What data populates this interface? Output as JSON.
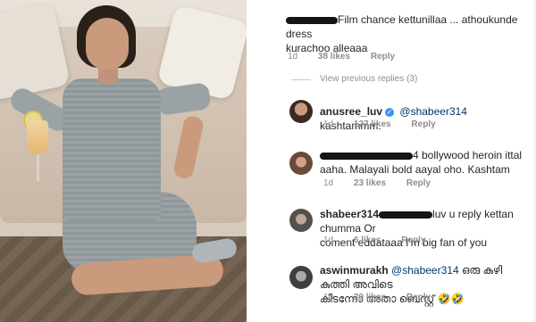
{
  "photo": {
    "alt_name": "post-photo"
  },
  "comments": [
    {
      "text": "Film chance kettunillaa ... athoukunde dress",
      "text2": "kurachoo alleaaa",
      "time": "1d",
      "likes": "38 likes",
      "reply": "Reply"
    },
    {
      "view_replies": "View previous replies (3)"
    },
    {
      "username": "anusree_luv",
      "mention": "@shabeer314",
      "text": " kashtammm.",
      "time": "1d",
      "likes": "127 likes",
      "reply": "Reply"
    },
    {
      "text": "4 bollywood heroin ittal",
      "text2": "aaha. Malayali bold aayal oho. Kashtam",
      "time": "1d",
      "likes": "23 likes",
      "reply": "Reply"
    },
    {
      "username_prefix": "shabeer314",
      "text": "luv u reply kettan chumma Or",
      "text2": "coment eddataaa I'm big fan of you",
      "time": "1d",
      "likes": "6 likes",
      "reply": "Reply"
    },
    {
      "username_prefix": "aswinmurakh",
      "mention": "@shabeer314",
      "text": " ഒരു കുഴി കുത്തി അവിടെ",
      "text2": "കിടന്നോ അതാ ബെസ്റ്റ് 🤣🤣",
      "time": "1d",
      "likes": "29 likes",
      "reply": "Reply"
    }
  ]
}
